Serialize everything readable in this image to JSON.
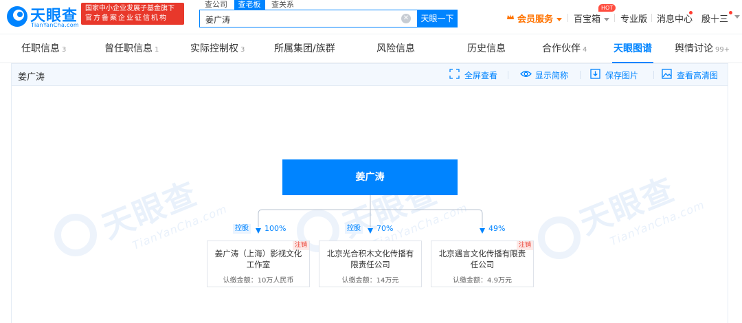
{
  "header": {
    "logo_cn": "天眼查",
    "logo_en": "TianYanCha.com",
    "gov_line1": "国家中小企业发展子基金旗下",
    "gov_line2": "官方备案企业征信机构",
    "search_tabs": [
      "查公司",
      "查老板",
      "查关系"
    ],
    "search_value": "姜广涛",
    "search_button": "天眼一下",
    "vip": "会员服务",
    "baibaoxiang": "百宝箱",
    "hot": "HOT",
    "pro": "专业版",
    "messages": "消息中心",
    "user": "殷十三"
  },
  "nav": {
    "tabs": [
      {
        "label": "任职信息",
        "count": "3"
      },
      {
        "label": "曾任职信息",
        "count": "1"
      },
      {
        "label": "实际控制权",
        "count": "3"
      },
      {
        "label": "所属集团/族群",
        "count": ""
      },
      {
        "label": "风险信息",
        "count": ""
      },
      {
        "label": "历史信息",
        "count": ""
      },
      {
        "label": "合作伙伴",
        "count": "4"
      },
      {
        "label": "天眼图谱",
        "count": ""
      },
      {
        "label": "舆情讨论",
        "count": "99+"
      }
    ],
    "active": "天眼图谱"
  },
  "panel": {
    "title": "姜广涛",
    "tools": {
      "fullscreen": "全屏查看",
      "short_name": "显示简称",
      "save": "保存图片",
      "hd": "查看高清图"
    }
  },
  "watermark": {
    "cn": "天眼查",
    "en": "TianYanCha.com"
  },
  "graph": {
    "root": "姜广涛",
    "children": [
      {
        "name": "姜广涛（上海）影视文化工作室",
        "relation": "控股",
        "percent": "100%",
        "amount": "认缴金额：10万人民币",
        "tag": "注销"
      },
      {
        "name": "北京光合积木文化传播有限责任公司",
        "relation": "控股",
        "percent": "70%",
        "amount": "认缴金额：14万元",
        "tag": ""
      },
      {
        "name": "北京遇言文化传播有限责任公司",
        "relation": "",
        "percent": "49%",
        "amount": "认缴金额：4.9万元",
        "tag": "注销"
      }
    ]
  },
  "colors": {
    "accent": "#0084ff",
    "danger": "#e8382b",
    "vip": "#ff7300"
  }
}
